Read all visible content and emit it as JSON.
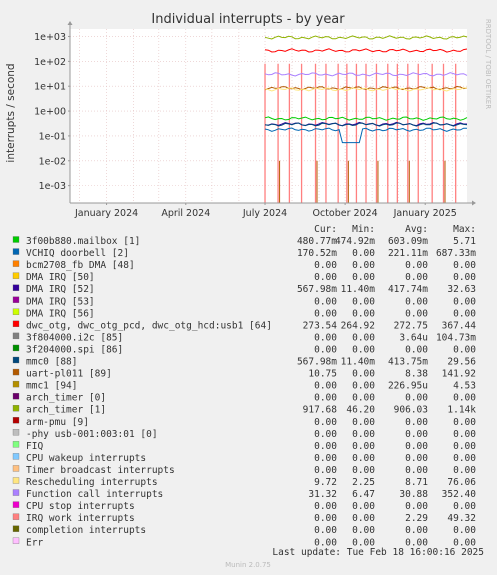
{
  "chart_data": {
    "type": "line",
    "title": "Individual interrupts - by year",
    "ylabel": "interrupts / second",
    "side_label": "RRDTOOL / TOBI OETIKER",
    "y_scale": "log",
    "ylim": [
      0.0002,
      2000
    ],
    "y_ticks": [
      {
        "value": 1000,
        "label": "1e+03"
      },
      {
        "value": 100,
        "label": "1e+02"
      },
      {
        "value": 10,
        "label": "1e+01"
      },
      {
        "value": 1,
        "label": "1e+00"
      },
      {
        "value": 0.1,
        "label": "1e-01"
      },
      {
        "value": 0.01,
        "label": "1e-02"
      },
      {
        "value": 0.001,
        "label": "1e-03"
      }
    ],
    "xlim": [
      "2023-11-20",
      "2025-02-18"
    ],
    "x_ticks": [
      {
        "date": "2024-01-01",
        "label": "January 2024"
      },
      {
        "date": "2024-04-01",
        "label": "April 2024"
      },
      {
        "date": "2024-07-01",
        "label": "July 2024"
      },
      {
        "date": "2024-10-01",
        "label": "October 2024"
      },
      {
        "date": "2025-01-01",
        "label": "January 2025"
      }
    ],
    "grid": true,
    "data_start": "2024-07-01",
    "legend_headers": {
      "cur": "Cur:",
      "min": "Min:",
      "avg": "Avg:",
      "max": "Max:"
    },
    "series": [
      {
        "name": "3f00b880.mailbox [1]",
        "color": "#00cc00",
        "cur": "480.77m",
        "min": "474.92m",
        "avg": "603.09m",
        "max": "5.71",
        "level": 0.5
      },
      {
        "name": "VCHIQ doorbell [2]",
        "color": "#0066b3",
        "cur": "170.52m",
        "min": "0.00",
        "avg": "221.11m",
        "max": "687.33m",
        "level": 0.18
      },
      {
        "name": "bcm2708_fb DMA [48]",
        "color": "#ff8000",
        "cur": "0.00",
        "min": "0.00",
        "avg": "0.00",
        "max": "0.00",
        "level": null
      },
      {
        "name": "DMA IRQ [50]",
        "color": "#ffcc00",
        "cur": "0.00",
        "min": "0.00",
        "avg": "0.00",
        "max": "0.00",
        "level": null
      },
      {
        "name": "DMA IRQ [52]",
        "color": "#330099",
        "cur": "567.98m",
        "min": "11.40m",
        "avg": "417.74m",
        "max": "32.63",
        "level": 0.3
      },
      {
        "name": "DMA IRQ [53]",
        "color": "#990099",
        "cur": "0.00",
        "min": "0.00",
        "avg": "0.00",
        "max": "0.00",
        "level": null
      },
      {
        "name": "DMA IRQ [56]",
        "color": "#ccff00",
        "cur": "0.00",
        "min": "0.00",
        "avg": "0.00",
        "max": "0.00",
        "level": null
      },
      {
        "name": "dwc_otg, dwc_otg_pcd, dwc_otg_hcd:usb1 [64]",
        "color": "#ff0000",
        "cur": "273.54",
        "min": "264.92",
        "avg": "272.75",
        "max": "367.44",
        "level": 272
      },
      {
        "name": "3f804000.i2c [85]",
        "color": "#808080",
        "cur": "0.00",
        "min": "0.00",
        "avg": "3.64u",
        "max": "104.73m",
        "level": null
      },
      {
        "name": "3f204000.spi [86]",
        "color": "#008f00",
        "cur": "0.00",
        "min": "0.00",
        "avg": "0.00",
        "max": "0.00",
        "level": null
      },
      {
        "name": "mmc0 [88]",
        "color": "#00487d",
        "cur": "567.98m",
        "min": "11.40m",
        "avg": "413.75m",
        "max": "29.56",
        "level": 0.29
      },
      {
        "name": "uart-pl011 [89]",
        "color": "#b35a00",
        "cur": "10.75",
        "min": "0.00",
        "avg": "8.38",
        "max": "141.92",
        "level": 8.4
      },
      {
        "name": "mmc1 [94]",
        "color": "#b38f00",
        "cur": "0.00",
        "min": "0.00",
        "avg": "226.95u",
        "max": "4.53",
        "level": null
      },
      {
        "name": "arch_timer [0]",
        "color": "#6b006b",
        "cur": "0.00",
        "min": "0.00",
        "avg": "0.00",
        "max": "0.00",
        "level": null
      },
      {
        "name": "arch_timer [1]",
        "color": "#8fb300",
        "cur": "917.68",
        "min": "46.20",
        "avg": "906.03",
        "max": "1.14k",
        "level": 906
      },
      {
        "name": "arm-pmu [9]",
        "color": "#b30000",
        "cur": "0.00",
        "min": "0.00",
        "avg": "0.00",
        "max": "0.00",
        "level": null
      },
      {
        "name": "-phy       usb-001:003:01 [0]",
        "color": "#bebebe",
        "cur": "0.00",
        "min": "0.00",
        "avg": "0.00",
        "max": "0.00",
        "level": null
      },
      {
        "name": "FIQ",
        "color": "#80ff80",
        "cur": "0.00",
        "min": "0.00",
        "avg": "0.00",
        "max": "0.00",
        "level": null
      },
      {
        "name": "CPU wakeup interrupts",
        "color": "#80c9ff",
        "cur": "0.00",
        "min": "0.00",
        "avg": "0.00",
        "max": "0.00",
        "level": null
      },
      {
        "name": "Timer broadcast interrupts",
        "color": "#ffc080",
        "cur": "0.00",
        "min": "0.00",
        "avg": "0.00",
        "max": "0.00",
        "level": null
      },
      {
        "name": "Rescheduling interrupts",
        "color": "#ffe680",
        "cur": "9.72",
        "min": "2.25",
        "avg": "8.71",
        "max": "76.06",
        "level": 7.5
      },
      {
        "name": "Function call interrupts",
        "color": "#aa80ff",
        "cur": "31.32",
        "min": "6.47",
        "avg": "30.88",
        "max": "352.40",
        "level": 30
      },
      {
        "name": "CPU stop interrupts",
        "color": "#ee00cc",
        "cur": "0.00",
        "min": "0.00",
        "avg": "0.00",
        "max": "0.00",
        "level": null
      },
      {
        "name": "IRQ work interrupts",
        "color": "#ff8080",
        "cur": "0.00",
        "min": "0.00",
        "avg": "2.29",
        "max": "49.32",
        "level": null
      },
      {
        "name": "completion interrupts",
        "color": "#666600",
        "cur": "0.00",
        "min": "0.00",
        "avg": "0.00",
        "max": "0.00",
        "level": null
      },
      {
        "name": "Err",
        "color": "#ffbfff",
        "cur": "0.00",
        "min": "0.00",
        "avg": "0.00",
        "max": "0.00",
        "level": null
      }
    ],
    "spikes": {
      "color": "#ff8080",
      "dates": [
        "2024-07-01",
        "2024-07-16",
        "2024-07-29",
        "2024-08-12",
        "2024-08-28",
        "2024-09-09",
        "2024-09-23",
        "2024-10-03",
        "2024-10-14",
        "2024-10-25",
        "2024-11-06",
        "2024-11-19",
        "2024-11-30",
        "2024-12-12",
        "2024-12-24",
        "2025-01-09",
        "2025-01-22",
        "2025-02-05"
      ]
    },
    "last_update": "Last update: Tue Feb 18 16:00:16 2025",
    "footer": "Munin 2.0.75"
  }
}
